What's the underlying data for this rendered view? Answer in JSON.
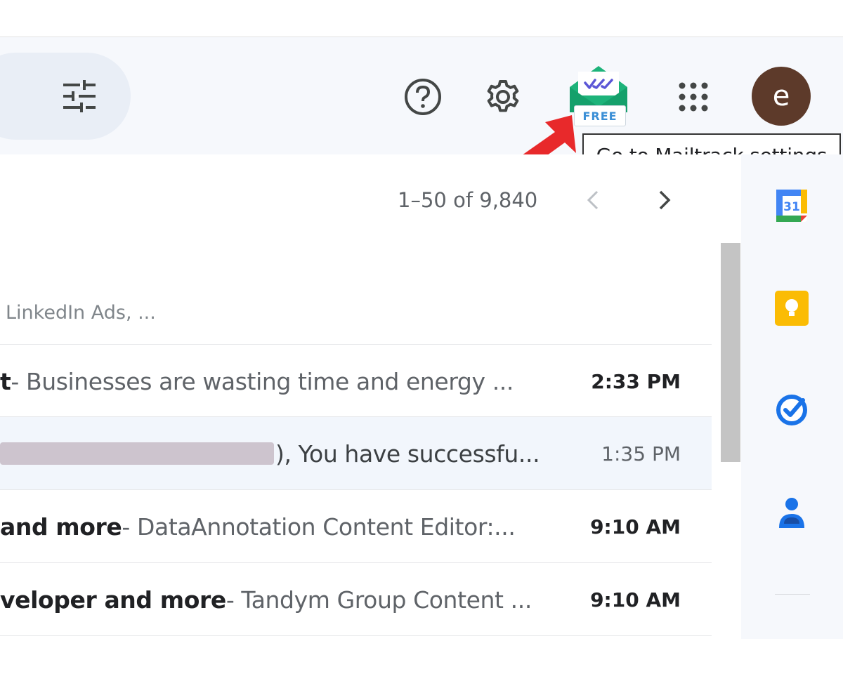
{
  "toolbar": {
    "filter_icon": "tune-icon",
    "help_icon": "help-circle-icon",
    "settings_icon": "gear-icon",
    "apps_icon": "grid-apps-icon",
    "avatar_letter": "e",
    "avatar_color": "#5d3a2a"
  },
  "mailtrack": {
    "badge": "FREE",
    "tooltip": "Go to Mailtrack settings",
    "accent": "#1db37a"
  },
  "pagination": {
    "range_text": "1–50 of 9,840"
  },
  "promotions": {
    "senders_text": "LinkedIn Ads, ..."
  },
  "emails": [
    {
      "subject": "t",
      "snippet": " - Businesses are wasting time and energy ...",
      "time": "2:33 PM",
      "unread": true,
      "redacted": false
    },
    {
      "subject": "",
      "snippet": "), You have successfu...",
      "time": "1:35 PM",
      "unread": false,
      "redacted": true
    },
    {
      "subject": " and more",
      "snippet": " - DataAnnotation Content Editor:...",
      "time": "9:10 AM",
      "unread": true,
      "redacted": false
    },
    {
      "subject": "veloper and more",
      "snippet": " - Tandym Group Content ...",
      "time": "9:10 AM",
      "unread": true,
      "redacted": false
    }
  ],
  "side_panel": {
    "items": [
      "calendar-icon",
      "keep-icon",
      "tasks-icon",
      "contacts-icon"
    ],
    "calendar_day": "31"
  }
}
